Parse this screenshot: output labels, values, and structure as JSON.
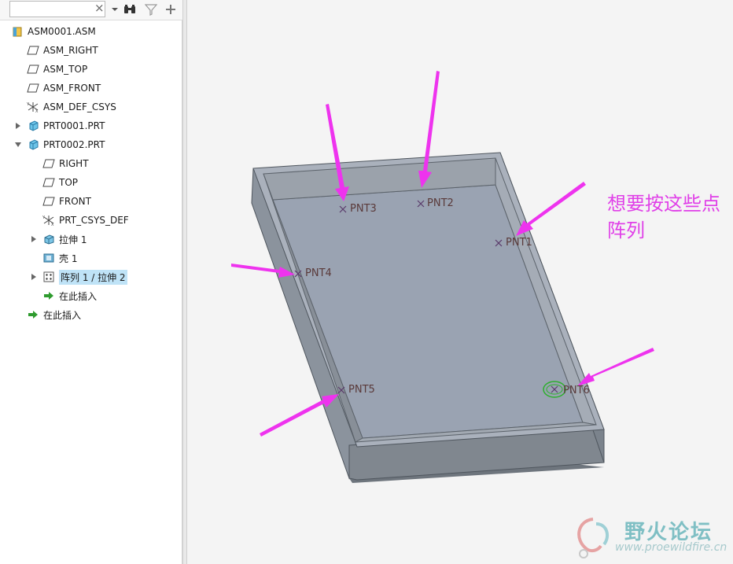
{
  "toolbar": {
    "search_value": "",
    "clear_glyph": "×",
    "icons": [
      "dropdown-icon",
      "find-icon",
      "filter-icon",
      "add-icon"
    ]
  },
  "tree": [
    {
      "label": "ASM0001.ASM",
      "icon": "assembly-icon"
    },
    {
      "label": "ASM_RIGHT",
      "icon": "datum-plane-icon"
    },
    {
      "label": "ASM_TOP",
      "icon": "datum-plane-icon"
    },
    {
      "label": "ASM_FRONT",
      "icon": "datum-plane-icon"
    },
    {
      "label": "ASM_DEF_CSYS",
      "icon": "csys-icon"
    },
    {
      "label": "PRT0001.PRT",
      "icon": "part-icon",
      "expander": "collapsed"
    },
    {
      "label": "PRT0002.PRT",
      "icon": "part-icon",
      "expander": "expanded"
    },
    {
      "label": "RIGHT",
      "icon": "datum-plane-icon"
    },
    {
      "label": "TOP",
      "icon": "datum-plane-icon"
    },
    {
      "label": "FRONT",
      "icon": "datum-plane-icon"
    },
    {
      "label": "PRT_CSYS_DEF",
      "icon": "csys-icon"
    },
    {
      "label": "拉伸 1",
      "icon": "extrude-icon",
      "expander": "collapsed"
    },
    {
      "label": "壳 1",
      "icon": "shell-icon"
    },
    {
      "label": "阵列 1 / 拉伸 2",
      "icon": "pattern-icon",
      "expander": "collapsed",
      "selected": true
    },
    {
      "label": "在此插入",
      "icon": "insert-here-icon"
    },
    {
      "label": "在此插入",
      "icon": "insert-here-icon"
    }
  ],
  "points": [
    "PNT3",
    "PNT2",
    "PNT1",
    "PNT4",
    "PNT5",
    "PNT6"
  ],
  "annotation": "想要按这些点阵列",
  "watermark": {
    "title": "野火论坛",
    "url": "www.proewildfire.cn"
  },
  "colors": {
    "arrow": "#ee33ee",
    "selection": "#bfe3f7",
    "tray_floor": "#9aa3b2",
    "tray_wall": "#8a929c",
    "annotation": "#e040e8"
  }
}
